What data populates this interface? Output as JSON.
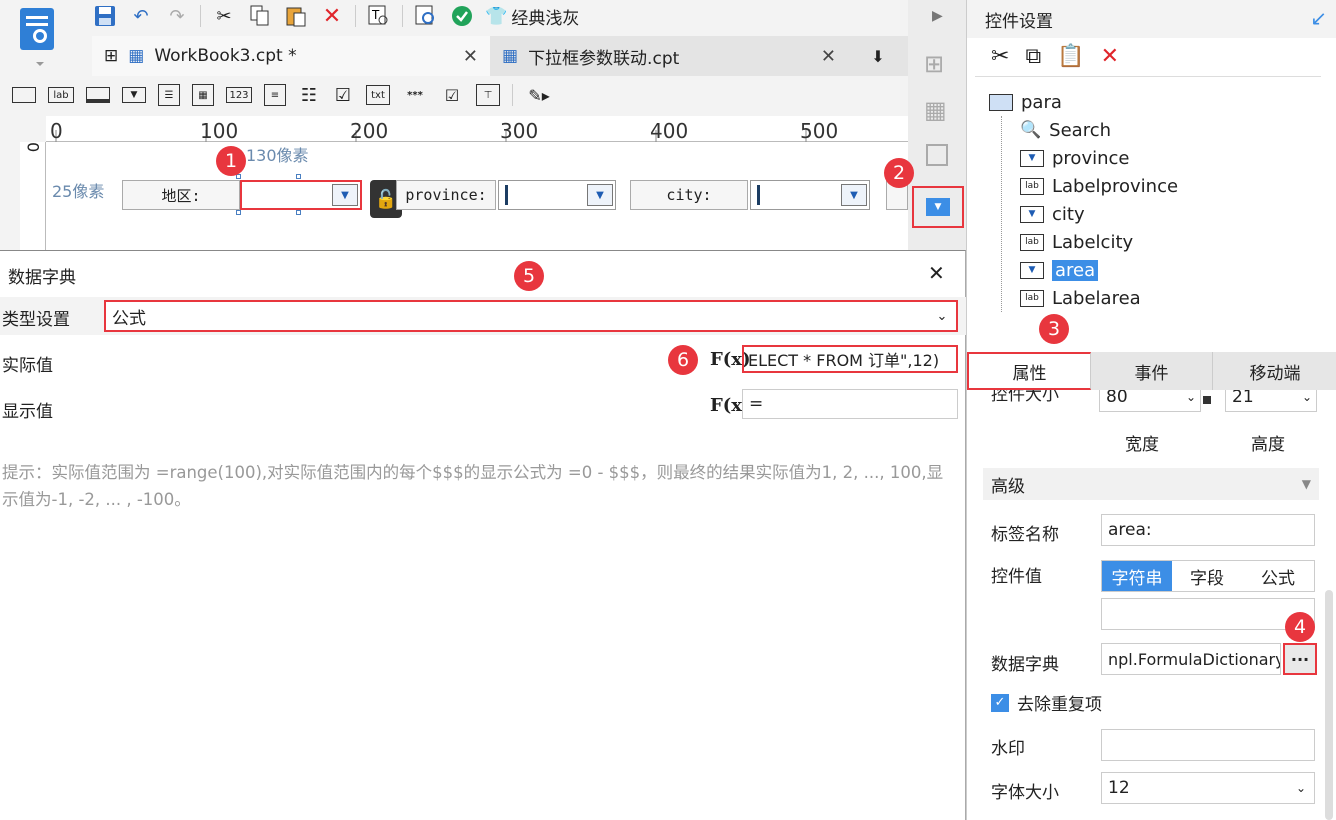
{
  "toolbar": {
    "theme_label": "经典浅灰"
  },
  "tabs": [
    {
      "label": "WorkBook3.cpt *",
      "close": "✕"
    },
    {
      "label": "下拉框参数联动.cpt",
      "close": "✕"
    }
  ],
  "widget_icons": {
    "lab": "lab",
    "num": "123",
    "txt": "txt",
    "pwd": "***"
  },
  "ruler": {
    "marks": [
      "0",
      "100",
      "200",
      "300",
      "400",
      "500"
    ],
    "v_mark": "0"
  },
  "canvas": {
    "width_note": "130像素",
    "height_note": "25像素",
    "label_area": "地区:",
    "label_province": "province:",
    "label_city": "city:"
  },
  "badges": [
    "1",
    "2",
    "3",
    "4",
    "5",
    "6"
  ],
  "right_panel": {
    "title": "控件设置",
    "tree": [
      {
        "label": "para",
        "icon": "para-icon",
        "level": 0
      },
      {
        "label": "Search",
        "icon": "search-widget-icon",
        "level": 1
      },
      {
        "label": "province",
        "icon": "combobox-icon",
        "level": 1
      },
      {
        "label": "Labelprovince",
        "icon": "label-icon",
        "level": 1
      },
      {
        "label": "city",
        "icon": "combobox-icon",
        "level": 1
      },
      {
        "label": "Labelcity",
        "icon": "label-icon",
        "level": 1
      },
      {
        "label": "area",
        "icon": "combobox-icon",
        "level": 1,
        "selected": true
      },
      {
        "label": "Labelarea",
        "icon": "label-icon",
        "level": 1
      }
    ],
    "tabs": [
      "属性",
      "事件",
      "移动端"
    ],
    "size_label": "控件大小",
    "width_value": "80",
    "height_value": "21",
    "width_label": "宽度",
    "height_label": "高度",
    "advanced": "高级",
    "label_name_label": "标签名称",
    "label_name_value": "area:",
    "widget_value_label": "控件值",
    "value_modes": [
      "字符串",
      "字段",
      "公式"
    ],
    "dict_label": "数据字典",
    "dict_value": "npl.FormulaDictionary",
    "dict_button": "···",
    "dedup_label": "去除重复项",
    "watermark_label": "水印",
    "fontsize_label": "字体大小",
    "fontsize_value": "12"
  },
  "dialog": {
    "title": "数据字典",
    "close": "✕",
    "type_label": "类型设置",
    "type_value": "公式",
    "actual_label": "实际值",
    "actual_value": "ELECT * FROM 订单\",12)",
    "display_label": "显示值",
    "display_value": "=",
    "fx": "F(x)",
    "hint": "提示：实际值范围为 =range(100),对实际值范围内的每个$$$的显示公式为 =0 - $$$，则最终的结果实际值为1, 2, ..., 100,显示值为-1, -2, ... , -100。"
  },
  "colors": {
    "accent": "#3c8ee6",
    "highlight": "#e8363e"
  }
}
